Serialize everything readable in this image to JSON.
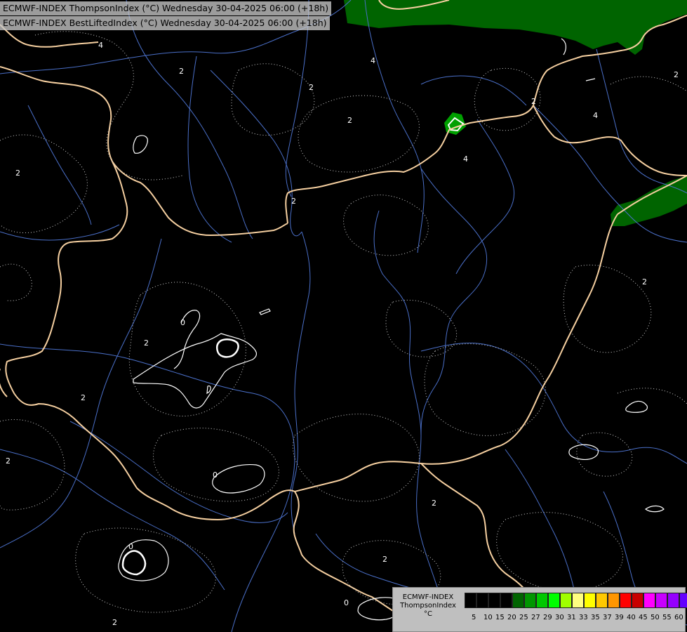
{
  "titles": {
    "line1": "ECMWF-INDEX ThompsonIndex (°C) Wednesday 30-04-2025 06:00 (+18h)",
    "line2": "ECMWF-INDEX BestLiftedIndex (°C) Wednesday 30-04-2025 06:00 (+18h)"
  },
  "contour_labels": {
    "two": "2",
    "four": "4",
    "zero": "0"
  },
  "legend": {
    "line1": "ECMWF-INDEX",
    "line2": "ThompsonIndex",
    "line3": "°C",
    "colors": [
      "#000000",
      "#000000",
      "#000000",
      "#000000",
      "#006400",
      "#009600",
      "#00c800",
      "#00ff00",
      "#a0ff00",
      "#ffff80",
      "#ffff00",
      "#ffc800",
      "#ff9600",
      "#ff0000",
      "#c80000",
      "#ff00ff",
      "#c800ff",
      "#9600ff",
      "#6400ff",
      "#0000ff"
    ],
    "ticks": [
      "5",
      "10",
      "15",
      "20",
      "25",
      "27",
      "29",
      "30",
      "31",
      "33",
      "35",
      "37",
      "39",
      "40",
      "45",
      "50",
      "55",
      "60"
    ]
  },
  "colors": {
    "background": "#000000",
    "border": "#f5cfa0",
    "river": "#4a6fc8",
    "thompson_area": "#006400",
    "bli_contour": "#ffffff"
  }
}
